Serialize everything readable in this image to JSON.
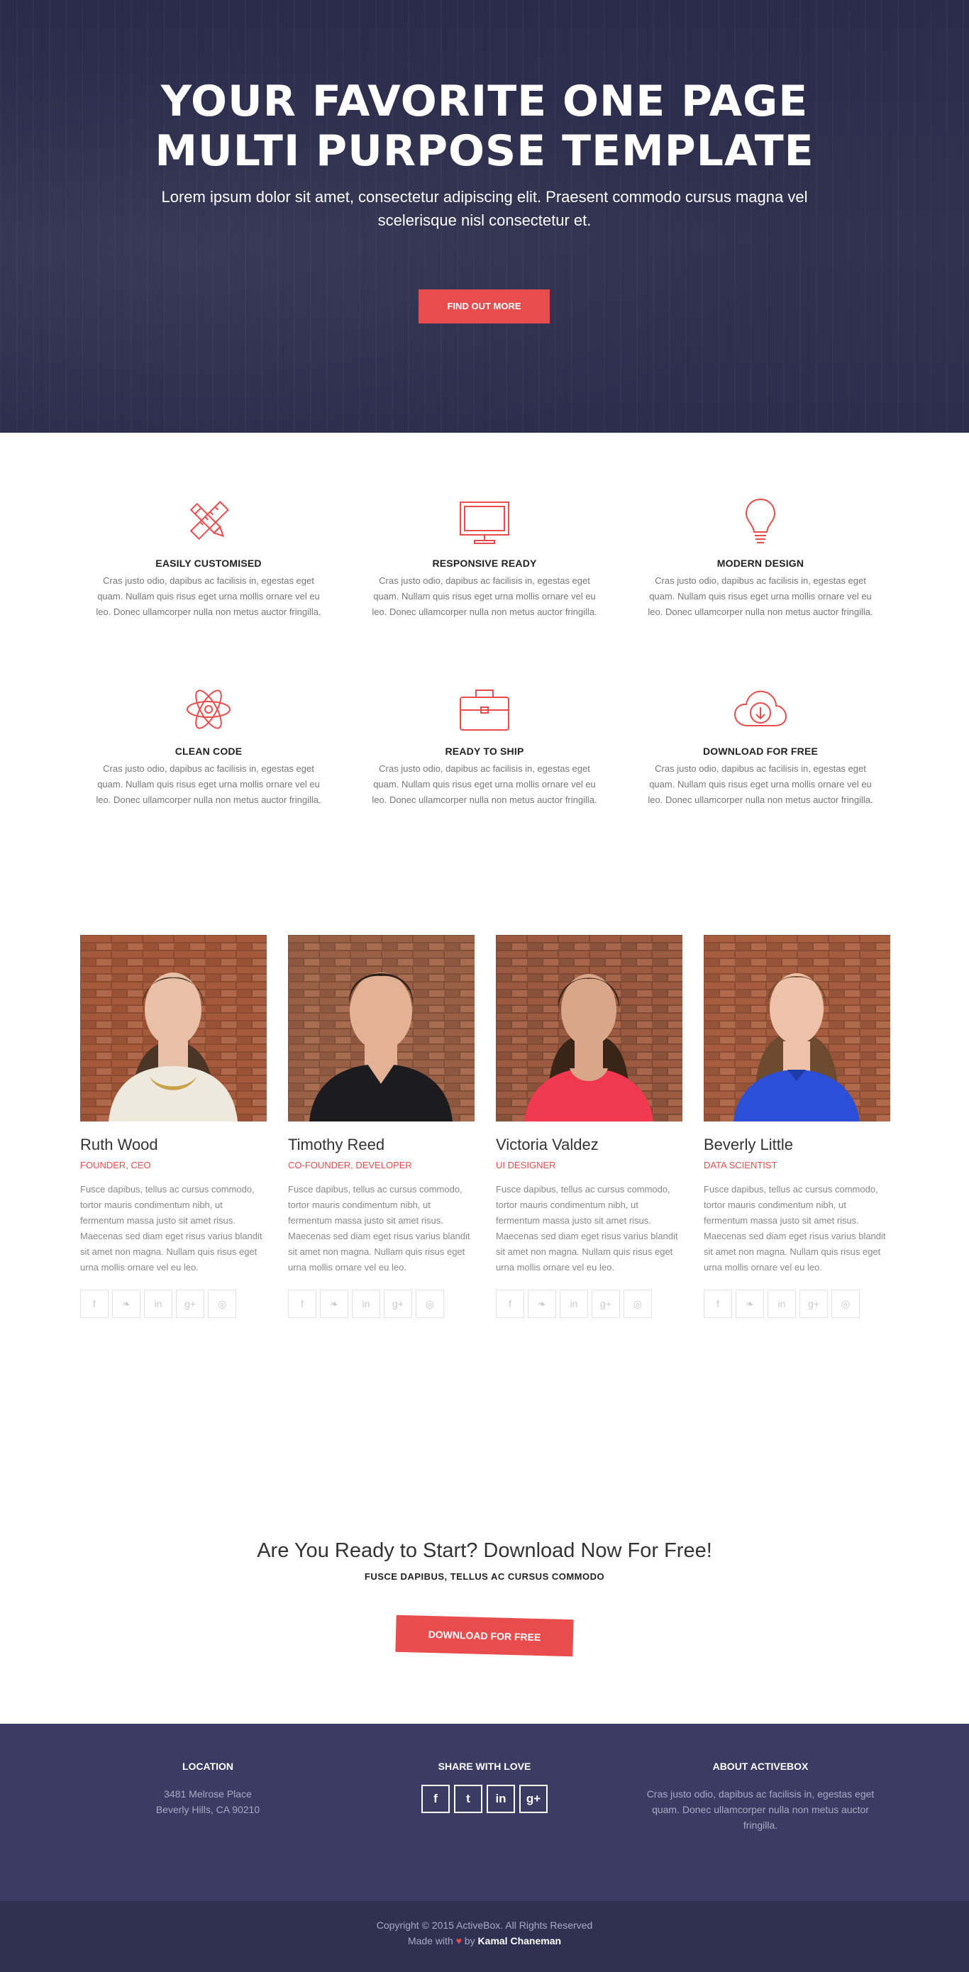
{
  "hero": {
    "title_line1": "YOUR FAVORITE ONE PAGE",
    "title_line2": "MULTI PURPOSE TEMPLATE",
    "subtitle": "Lorem ipsum dolor sit amet, consectetur adipiscing elit. Praesent commodo cursus magna vel scelerisque nisl consectetur et.",
    "cta_label": "FIND OUT MORE"
  },
  "features": [
    {
      "icon": "pencil-ruler-icon",
      "title": "EASILY CUSTOMISED",
      "text": "Cras justo odio, dapibus ac facilisis in, egestas eget quam. Nullam quis risus eget urna mollis ornare vel eu leo. Donec ullamcorper nulla non metus auctor fringilla."
    },
    {
      "icon": "monitor-icon",
      "title": "RESPONSIVE READY",
      "text": "Cras justo odio, dapibus ac facilisis in, egestas eget quam. Nullam quis risus eget urna mollis ornare vel eu leo. Donec ullamcorper nulla non metus auctor fringilla."
    },
    {
      "icon": "lightbulb-icon",
      "title": "MODERN DESIGN",
      "text": "Cras justo odio, dapibus ac facilisis in, egestas eget quam. Nullam quis risus eget urna mollis ornare vel eu leo. Donec ullamcorper nulla non metus auctor fringilla."
    },
    {
      "icon": "atom-icon",
      "title": "CLEAN CODE",
      "text": "Cras justo odio, dapibus ac facilisis in, egestas eget quam. Nullam quis risus eget urna mollis ornare vel eu leo. Donec ullamcorper nulla non metus auctor fringilla."
    },
    {
      "icon": "briefcase-icon",
      "title": "READY TO SHIP",
      "text": "Cras justo odio, dapibus ac facilisis in, egestas eget quam. Nullam quis risus eget urna mollis ornare vel eu leo. Donec ullamcorper nulla non metus auctor fringilla."
    },
    {
      "icon": "cloud-download-icon",
      "title": "DOWNLOAD FOR FREE",
      "text": "Cras justo odio, dapibus ac facilisis in, egestas eget quam. Nullam quis risus eget urna mollis ornare vel eu leo. Donec ullamcorper nulla non metus auctor fringilla."
    }
  ],
  "team": [
    {
      "name": "Ruth Wood",
      "role": "FOUNDER, CEO",
      "bio": "Fusce dapibus, tellus ac cursus commodo, tortor mauris condimentum nibh, ut fermentum massa justo sit amet risus. Maecenas sed diam eget risus varius blandit sit amet non magna. Nullam quis risus eget urna mollis ornare vel eu leo.",
      "shirt": "#efe8dd",
      "hair": "#4a3526",
      "skin": "#e8c0a8"
    },
    {
      "name": "Timothy Reed",
      "role": "CO-FOUNDER, DEVELOPER",
      "bio": "Fusce dapibus, tellus ac cursus commodo, tortor mauris condimentum nibh, ut fermentum massa justo sit amet risus. Maecenas sed diam eget risus varius blandit sit amet non magna. Nullam quis risus eget urna mollis ornare vel eu leo.",
      "shirt": "#1c1c1e",
      "hair": "#2e2018",
      "skin": "#e2b196"
    },
    {
      "name": "Victoria Valdez",
      "role": "UI DESIGNER",
      "bio": "Fusce dapibus, tellus ac cursus commodo, tortor mauris condimentum nibh, ut fermentum massa justo sit amet risus. Maecenas sed diam eget risus varius blandit sit amet non magna. Nullam quis risus eget urna mollis ornare vel eu leo.",
      "shirt": "#f0384e",
      "hair": "#3a2418",
      "skin": "#d9a68a"
    },
    {
      "name": "Beverly Little",
      "role": "DATA SCIENTIST",
      "bio": "Fusce dapibus, tellus ac cursus commodo, tortor mauris condimentum nibh, ut fermentum massa justo sit amet risus. Maecenas sed diam eget risus varius blandit sit amet non magna. Nullam quis risus eget urna mollis ornare vel eu leo.",
      "shirt": "#2b4fd6",
      "hair": "#6b4a2e",
      "skin": "#eec2a8"
    }
  ],
  "social_icons": [
    {
      "icon": "facebook-icon",
      "glyph": "f"
    },
    {
      "icon": "twitter-icon",
      "glyph": "❧"
    },
    {
      "icon": "linkedin-icon",
      "glyph": "in"
    },
    {
      "icon": "google-plus-icon",
      "glyph": "g+"
    },
    {
      "icon": "dribbble-icon",
      "glyph": "◎"
    }
  ],
  "cta": {
    "heading": "Are You Ready to Start? Download Now For Free!",
    "subheading": "FUSCE DAPIBUS, TELLUS AC CURSUS COMMODO",
    "button_label": "DOWNLOAD FOR FREE"
  },
  "footer": {
    "location_title": "LOCATION",
    "address_line1": "3481 Melrose Place",
    "address_line2": "Beverly Hills, CA 90210",
    "share_title": "SHARE WITH LOVE",
    "share_icons": [
      {
        "icon": "facebook-icon",
        "glyph": "f"
      },
      {
        "icon": "twitter-icon",
        "glyph": "t"
      },
      {
        "icon": "linkedin-icon",
        "glyph": "in"
      },
      {
        "icon": "google-plus-icon",
        "glyph": "g+"
      }
    ],
    "about_title": "ABOUT ACTIVEBOX",
    "about_text": "Cras justo odio, dapibus ac facilisis in, egestas eget quam. Donec ullamcorper nulla non metus auctor fringilla."
  },
  "copyright": {
    "line1": "Copyright © 2015 ActiveBox. All Rights Reserved",
    "made_with": "Made with",
    "heart": "♥",
    "by": "by",
    "author": "Kamal Chaneman"
  },
  "colors": {
    "accent": "#e84c4c",
    "hero_bg": "#2b2d4d",
    "footer_bg": "#3a3c63",
    "copyright_bg": "#2f3152"
  }
}
